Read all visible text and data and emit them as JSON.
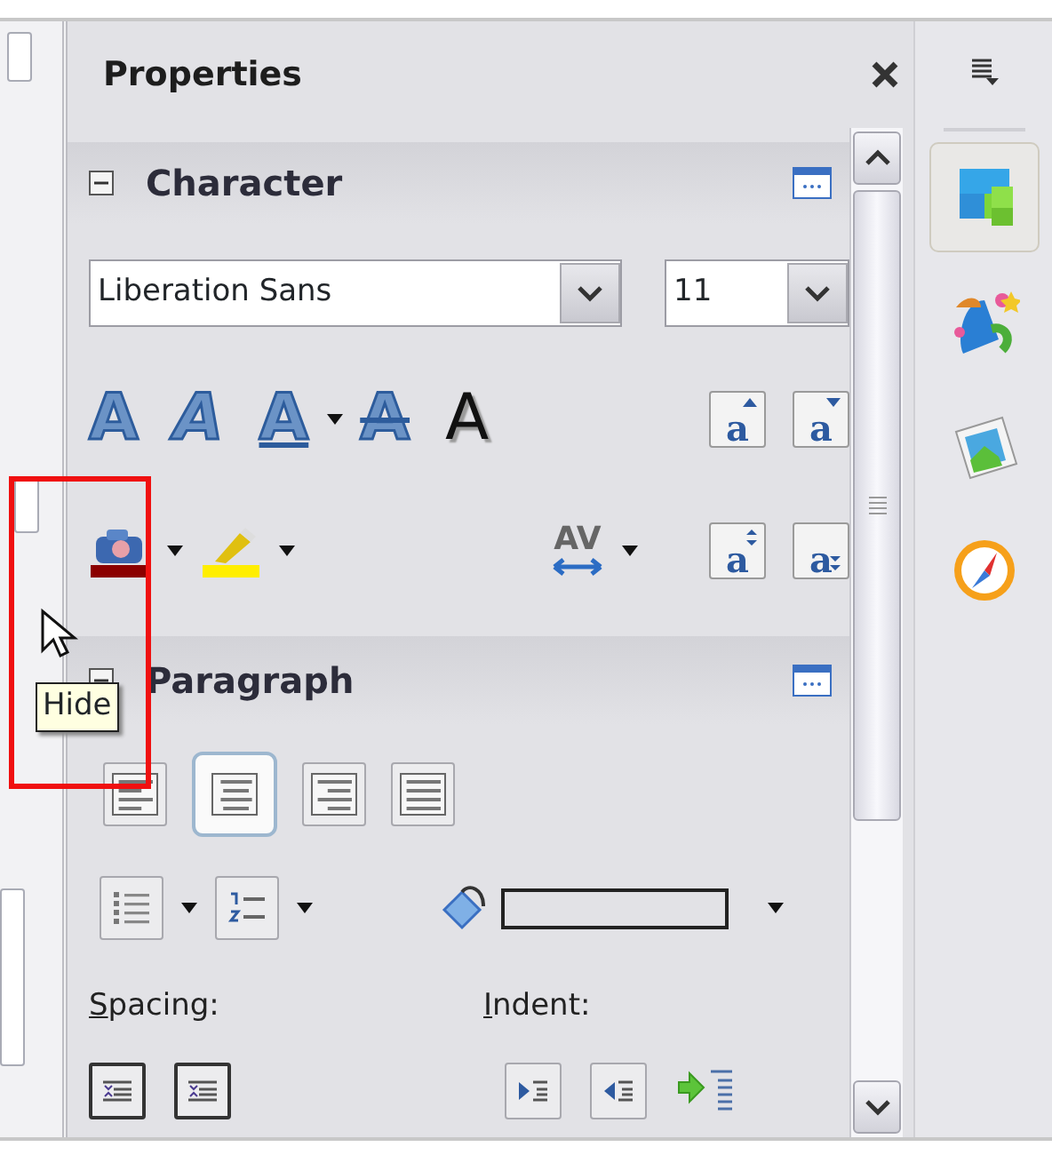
{
  "panel": {
    "title": "Properties"
  },
  "character": {
    "title": "Character",
    "expanded": true,
    "font_name": "Liberation Sans",
    "font_size": "11",
    "style_tools": [
      {
        "kind": "bold",
        "glyph": "A",
        "dropdown": false
      },
      {
        "kind": "italic",
        "glyph": "A",
        "dropdown": false
      },
      {
        "kind": "underline",
        "glyph": "A",
        "dropdown": true
      },
      {
        "kind": "strike",
        "glyph": "A",
        "dropdown": false
      },
      {
        "kind": "shadow",
        "glyph": "A",
        "dropdown": false
      }
    ],
    "size_tools": [
      {
        "kind": "grow",
        "glyph": "a"
      },
      {
        "kind": "shrink",
        "glyph": "a"
      }
    ],
    "color_tools": [
      {
        "kind": "font",
        "color": "#8b0000"
      },
      {
        "kind": "highlight",
        "color": "#ffee00"
      }
    ],
    "spacing_tool": {
      "glyph": "AV"
    },
    "script_tools": [
      {
        "kind": "super",
        "glyph": "a"
      },
      {
        "kind": "sub",
        "glyph": "a"
      }
    ]
  },
  "paragraph": {
    "title": "Paragraph",
    "expanded": true,
    "align_buttons": [
      {
        "kind": "left",
        "selected": false
      },
      {
        "kind": "center",
        "selected": true
      },
      {
        "kind": "right",
        "selected": false
      },
      {
        "kind": "justify",
        "selected": false
      }
    ],
    "list_buttons": [
      {
        "kind": "bullets"
      },
      {
        "kind": "numbering"
      }
    ],
    "spacing_label": "Spacing:",
    "indent_label": "Indent:"
  },
  "deck_tabs": [
    {
      "kind": "properties",
      "selected": true
    },
    {
      "kind": "styles",
      "selected": false
    },
    {
      "kind": "gallery",
      "selected": false
    },
    {
      "kind": "navigator",
      "selected": false
    }
  ],
  "tooltip": "Hide"
}
